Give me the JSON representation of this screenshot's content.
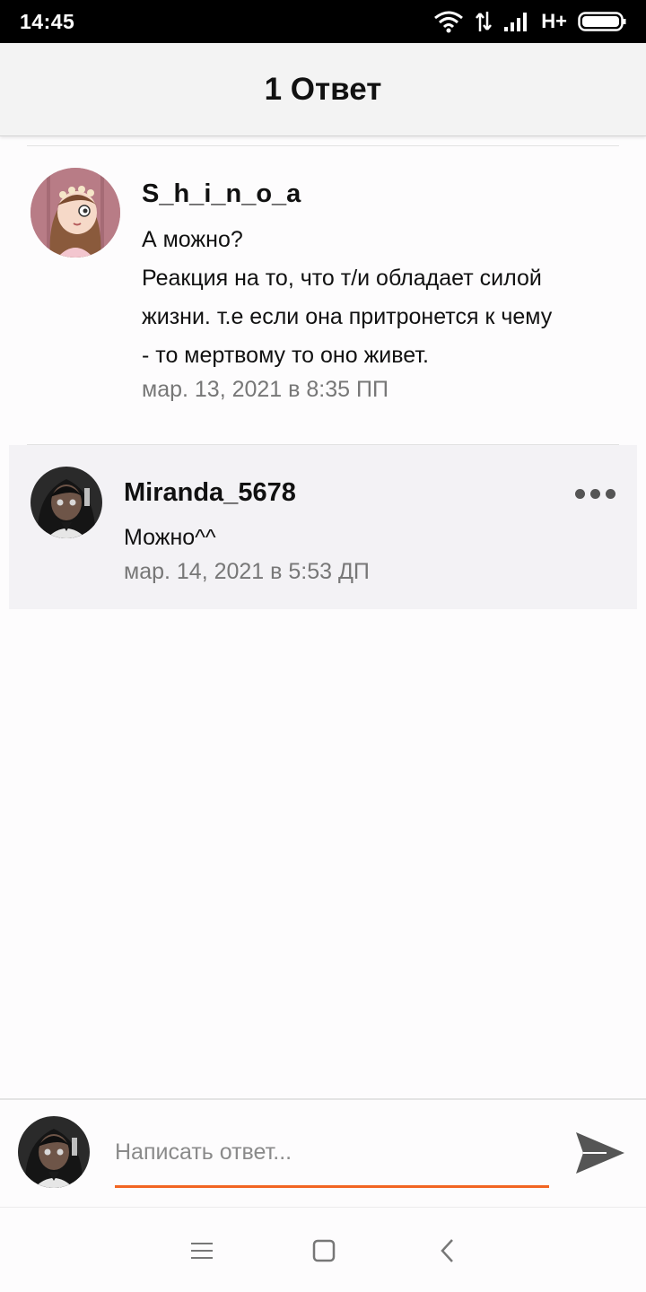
{
  "status_bar": {
    "time": "14:45",
    "network": "H+",
    "icons": [
      "wifi-icon",
      "data-arrows-icon",
      "signal-icon",
      "battery-icon"
    ]
  },
  "header": {
    "title": "1 Ответ"
  },
  "comment": {
    "author": "S_h_i_n_o_a",
    "lines": [
      "А можно?",
      "Реакция на то, что т/и обладает силой",
      "жизни. т.е если она притронется к чему",
      "- то мертвому то оно живет."
    ],
    "date": "мар. 13, 2021 в 8:35 ПП"
  },
  "reply": {
    "author": "Miranda_5678",
    "text": "Можно^^",
    "date": "мар. 14, 2021 в 5:53 ДП",
    "more_icon": "more-dots-icon"
  },
  "input_bar": {
    "placeholder": "Написать ответ...",
    "send_icon": "send-icon",
    "accent_color": "#f26522"
  },
  "nav_bar": {
    "icons": [
      "menu-icon",
      "home-square-icon",
      "back-chevron-icon"
    ]
  }
}
